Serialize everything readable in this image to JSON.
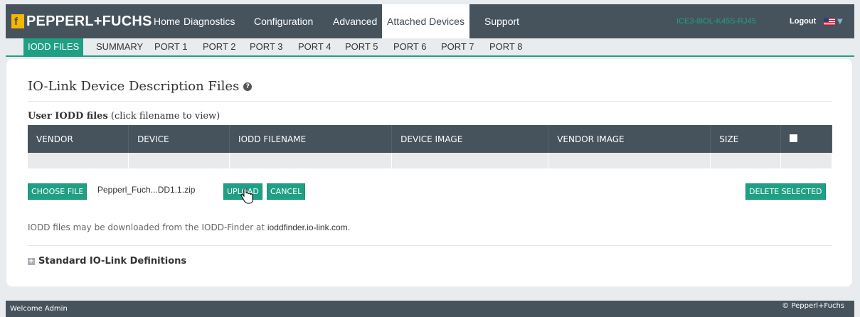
{
  "brand": {
    "name": "PEPPERL+FUCHS",
    "logo_mark": "f"
  },
  "nav": {
    "items": [
      "Home",
      "Diagnostics",
      "Configuration",
      "Advanced",
      "Attached Devices",
      "Support"
    ],
    "active": "Attached Devices",
    "device_name": "ICE3-8IOL-K45S-RJ45",
    "logout_label": "Logout",
    "language_icon": "us-flag-icon"
  },
  "subnav": {
    "items": [
      "IODD FILES",
      "SUMMARY",
      "PORT 1",
      "PORT 2",
      "PORT 3",
      "PORT 4",
      "PORT 5",
      "PORT 6",
      "PORT 7",
      "PORT 8"
    ],
    "active": "IODD FILES"
  },
  "page": {
    "title": "IO-Link Device Description Files",
    "section_title": "User IODD files",
    "section_hint": "(click filename to view)"
  },
  "table": {
    "columns": [
      "VENDOR",
      "DEVICE",
      "IODD FILENAME",
      "DEVICE IMAGE",
      "VENDOR IMAGE",
      "SIZE"
    ],
    "rows": []
  },
  "actions": {
    "choose_file_label": "CHOOSE FILE",
    "selected_file": "Pepperl_Fuch...DD1.1.zip",
    "upload_label": "UPLOAD",
    "cancel_label": "CANCEL",
    "delete_selected_label": "DELETE SELECTED"
  },
  "info": {
    "text": "IODD files may be downloaded from the IODD-Finder at",
    "link": "ioddfinder.io-link.com",
    "suffix": "."
  },
  "standard_defs_label": "Standard IO-Link Definitions",
  "footer": {
    "welcome": "Welcome Admin",
    "copyright": "© Pepperl+Fuchs"
  },
  "colors": {
    "accent": "#1fa085",
    "nav_bg": "#46535d",
    "brand_logo": "#f5b600"
  }
}
